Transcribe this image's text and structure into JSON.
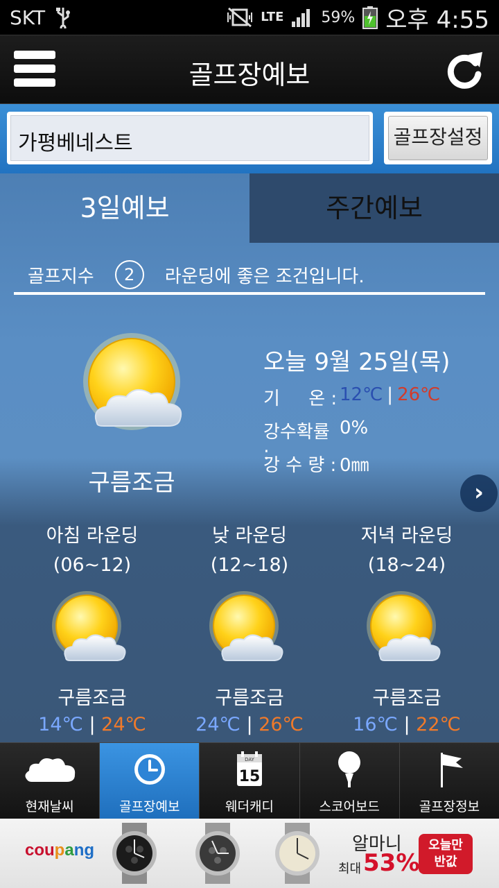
{
  "status_bar": {
    "carrier": "SKT",
    "network": "LTE",
    "battery": "59%",
    "time": "오후 4:55"
  },
  "header": {
    "title": "골프장예보",
    "menu_icon": "hamburger-menu-icon",
    "refresh_icon": "refresh-icon"
  },
  "course": {
    "name": "가평베네스트",
    "settings_button": "골프장설정"
  },
  "tabs": [
    {
      "label": "3일예보",
      "active": true
    },
    {
      "label": "주간예보",
      "active": false
    }
  ],
  "golf_index": {
    "label": "골프지수",
    "value": "2",
    "message": "라운딩에 좋은 조건입니다."
  },
  "today": {
    "date": "오늘 9월 25일(목)",
    "condition": "구름조금",
    "icon": "partly-cloudy-icon",
    "temp_label": "기     온 :",
    "temp_low": "12℃",
    "temp_sep": "|",
    "temp_high": "26℃",
    "prob_label": "강수확률 :",
    "prob_value": "0%",
    "rain_label": "강 수 량 :",
    "rain_value": "0㎜"
  },
  "next_button": "›",
  "rounds": [
    {
      "name": "아침 라운딩",
      "hours": "(06~12)",
      "condition": "구름조금",
      "low": "14℃",
      "sep": "|",
      "high": "24℃"
    },
    {
      "name": "낮 라운딩",
      "hours": "(12~18)",
      "condition": "구름조금",
      "low": "24℃",
      "sep": "|",
      "high": "26℃"
    },
    {
      "name": "저녁 라운딩",
      "hours": "(18~24)",
      "condition": "구름조금",
      "low": "16℃",
      "sep": "|",
      "high": "22℃"
    }
  ],
  "bottom_nav": [
    {
      "label": "현재날씨",
      "icon": "cloud-icon",
      "active": false
    },
    {
      "label": "골프장예보",
      "icon": "clock-icon",
      "active": true
    },
    {
      "label": "웨더캐디",
      "icon": "calendar-icon",
      "calendar_day": "15",
      "calendar_tag": "DAY",
      "active": false
    },
    {
      "label": "스코어보드",
      "icon": "golf-ball-icon",
      "active": false
    },
    {
      "label": "골프장정보",
      "icon": "flag-icon",
      "active": false
    }
  ],
  "ad": {
    "brand": [
      "cou",
      "p",
      "a",
      "ng"
    ],
    "product": "알마니",
    "max_label": "최대",
    "discount": "53%",
    "cta_line1": "오늘만",
    "cta_line2": "반값"
  },
  "colors": {
    "temp_low": "#2a4fb0",
    "temp_high": "#d23b2a",
    "accent_blue": "#2173c1"
  }
}
